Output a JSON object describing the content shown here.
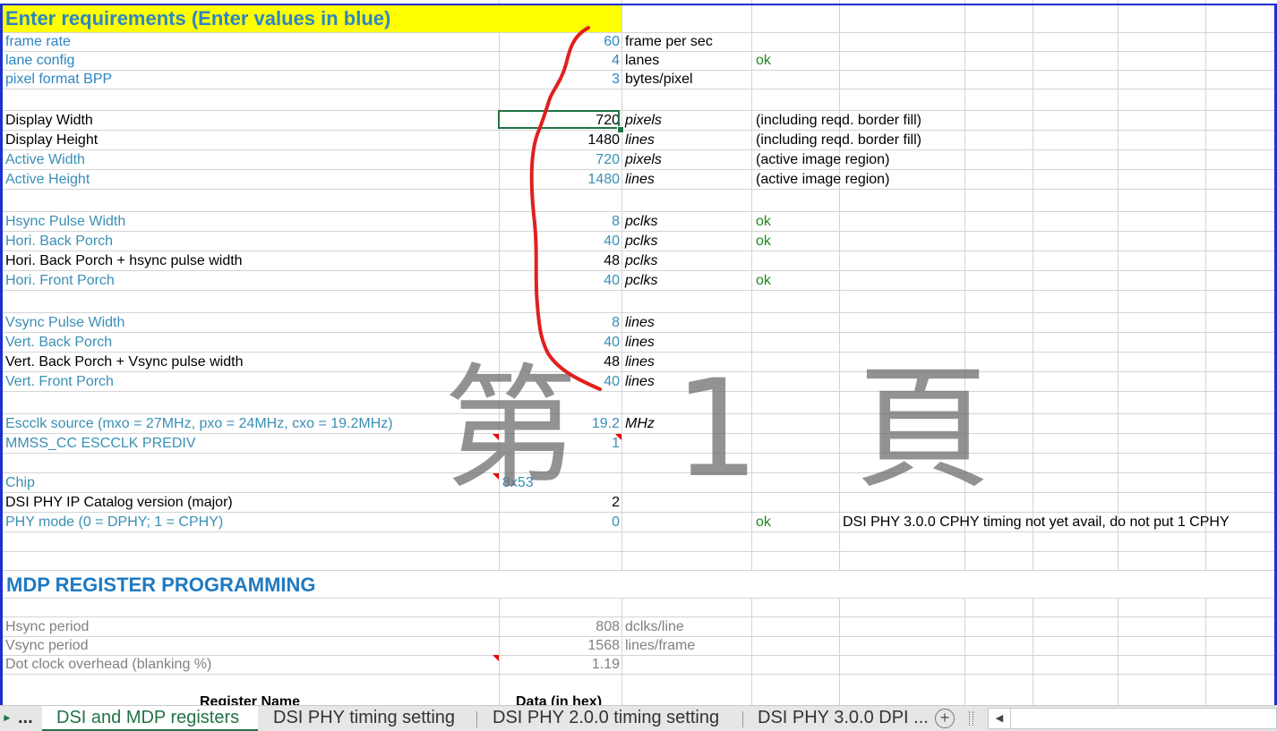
{
  "sheet": {
    "header_title": "Enter requirements (Enter values in blue)",
    "frame_rate": {
      "label": "frame rate",
      "value": "60",
      "unit": "frame per sec"
    },
    "lane_config": {
      "label": "lane config",
      "value": "4",
      "unit": "lanes",
      "status": "ok"
    },
    "pixel_format": {
      "label": "pixel format BPP",
      "value": "3",
      "unit": "bytes/pixel"
    },
    "display_width": {
      "label": "Display Width",
      "value": "720",
      "unit": "pixels",
      "note": "(including reqd. border fill)"
    },
    "display_height": {
      "label": "Display Height",
      "value": "1480",
      "unit": "lines",
      "note": "(including reqd. border fill)"
    },
    "active_width": {
      "label": "Active Width",
      "value": "720",
      "unit": "pixels",
      "note": "(active image region)"
    },
    "active_height": {
      "label": "Active Height",
      "value": "1480",
      "unit": "lines",
      "note": "(active image region)"
    },
    "hsync_pulse": {
      "label": "Hsync Pulse Width",
      "value": "8",
      "unit": "pclks",
      "status": "ok"
    },
    "hori_back_porch": {
      "label": "Hori. Back Porch",
      "value": "40",
      "unit": "pclks",
      "status": "ok"
    },
    "hori_bp_hsync": {
      "label": "Hori. Back Porch + hsync pulse width",
      "value": "48",
      "unit": "pclks"
    },
    "hori_front_porch": {
      "label": "Hori. Front Porch",
      "value": "40",
      "unit": "pclks",
      "status": "ok"
    },
    "vsync_pulse": {
      "label": "Vsync Pulse Width",
      "value": "8",
      "unit": "lines"
    },
    "vert_back_porch": {
      "label": "Vert. Back Porch",
      "value": "40",
      "unit": "lines"
    },
    "vert_bp_vsync": {
      "label": "Vert. Back Porch + Vsync pulse width",
      "value": "48",
      "unit": "lines"
    },
    "vert_front_porch": {
      "label": "Vert. Front Porch",
      "value": "40",
      "unit": "lines"
    },
    "escclk": {
      "label": "Escclk source (mxo = 27MHz, pxo = 24MHz, cxo = 19.2MHz)",
      "value": "19.2",
      "unit": "MHz"
    },
    "prediv": {
      "label": "MMSS_CC ESCCLK PREDIV",
      "value": "1"
    },
    "chip": {
      "label": "Chip",
      "value": "8x53"
    },
    "phy_catalog": {
      "label": "DSI PHY IP Catalog version (major)",
      "value": "2"
    },
    "phy_mode": {
      "label": "PHY mode (0 = DPHY; 1 = CPHY)",
      "value": "0",
      "status": "ok",
      "note": "DSI PHY 3.0.0 CPHY timing not yet avail, do not put 1 CPHY"
    },
    "mdp_title": "MDP REGISTER PROGRAMMING",
    "hsync_period": {
      "label": "Hsync period",
      "value": "808",
      "unit": "dclks/line"
    },
    "vsync_period": {
      "label": "Vsync period",
      "value": "1568",
      "unit": "lines/frame"
    },
    "dot_clock": {
      "label": "Dot clock overhead (blanking %)",
      "value": "1.19"
    },
    "reg_name_header": "Register Name",
    "data_hex_header": "Data (in hex)"
  },
  "watermark": "第 1 頁",
  "tabs": {
    "more": "...",
    "items": [
      "DSI and MDP registers",
      "DSI PHY timing setting",
      "DSI PHY 2.0.0 timing setting",
      "DSI PHY 3.0.0 DPI ..."
    ],
    "active_index": 0,
    "add": "+"
  },
  "colors": {
    "accent": "#217346",
    "input_blue": "#2e86c1",
    "header_fill": "#ffff00",
    "ok_green": "#1e8a1e",
    "annotation_red": "#e0201e"
  }
}
